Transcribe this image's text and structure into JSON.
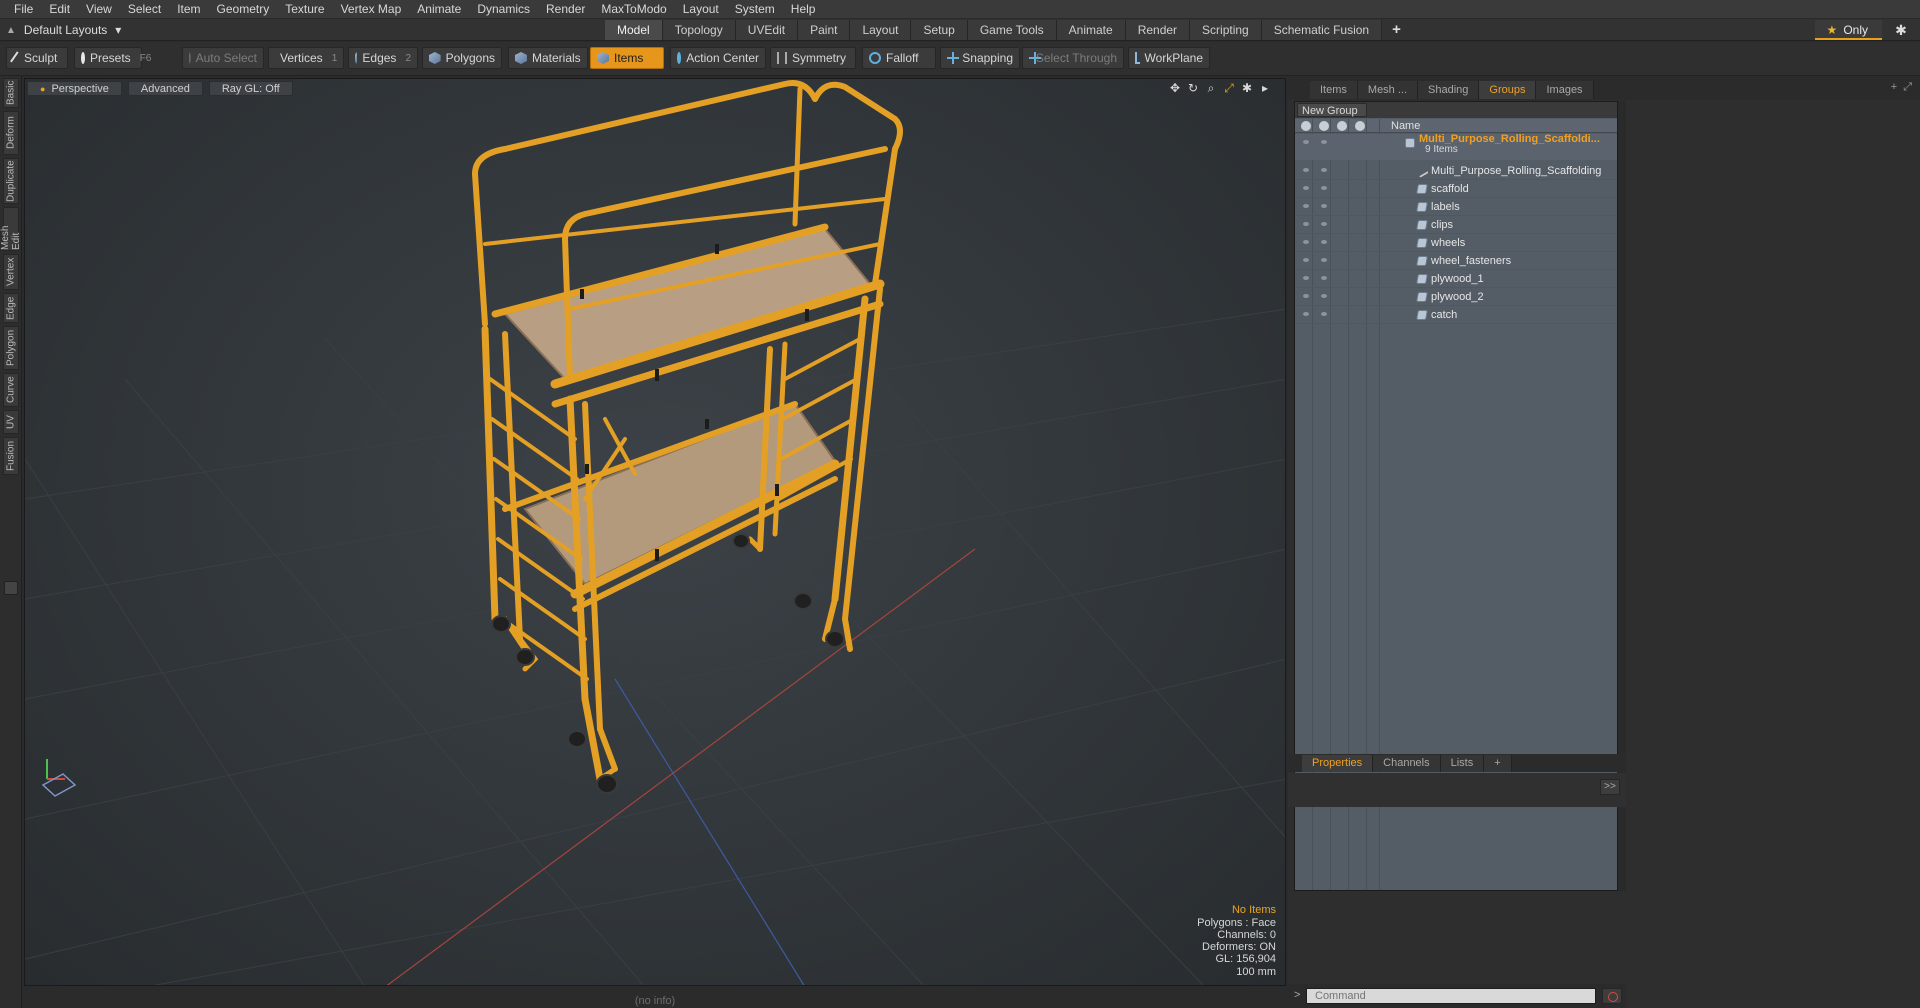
{
  "menu": [
    "File",
    "Edit",
    "View",
    "Select",
    "Item",
    "Geometry",
    "Texture",
    "Vertex Map",
    "Animate",
    "Dynamics",
    "Render",
    "MaxToModo",
    "Layout",
    "System",
    "Help"
  ],
  "layout": {
    "label": "Default Layouts",
    "arrow": "▾"
  },
  "tabs": [
    "Model",
    "Topology",
    "UVEdit",
    "Paint",
    "Layout",
    "Setup",
    "Game Tools",
    "Animate",
    "Render",
    "Scripting",
    "Schematic Fusion"
  ],
  "active_tab": "Model",
  "only_label": "Only",
  "toolbar": {
    "sculpt": "Sculpt",
    "presets": "Presets",
    "presets_key": "F6",
    "auto_select": "Auto Select",
    "vertices": "Vertices",
    "vertices_key": "1",
    "edges": "Edges",
    "edges_key": "2",
    "polygons": "Polygons",
    "materials": "Materials",
    "items": "Items",
    "action_center": "Action Center",
    "symmetry": "Symmetry",
    "falloff": "Falloff",
    "snapping": "Snapping",
    "select_through": "Select Through",
    "workplane": "WorkPlane"
  },
  "left_tabs": [
    "Basic",
    "Deform",
    "Duplicate",
    "Mesh Edit",
    "Vertex",
    "Edge",
    "Polygon",
    "Curve",
    "UV",
    "Fusion"
  ],
  "viewport": {
    "view": "Perspective",
    "shading": "Advanced",
    "raygl": "Ray GL: Off",
    "info": {
      "items": "No Items",
      "polygons": "Polygons : Face",
      "channels": "Channels: 0",
      "deformers": "Deformers: ON",
      "gl": "GL: 156,904",
      "scale": "100 mm"
    }
  },
  "status": "(no info)",
  "right_panel": {
    "tabs": [
      "Items",
      "Mesh ...",
      "Shading",
      "Groups",
      "Images"
    ],
    "active_tab": "Groups",
    "new_group": "New Group",
    "name_col": "Name",
    "root": {
      "label": "Multi_Purpose_Rolling_Scaffoldi...",
      "sub": "9 Items"
    },
    "children": [
      "Multi_Purpose_Rolling_Scaffolding",
      "scaffold",
      "labels",
      "clips",
      "wheels",
      "wheel_fasteners",
      "plywood_1",
      "plywood_2",
      "catch"
    ]
  },
  "properties_tabs": [
    "Properties",
    "Channels",
    "Lists"
  ],
  "properties_active": "Properties",
  "command_placeholder": "Command",
  "colors": {
    "accent": "#e8a21a",
    "scaffold": "#e3a024",
    "plank": "#b9a185"
  }
}
